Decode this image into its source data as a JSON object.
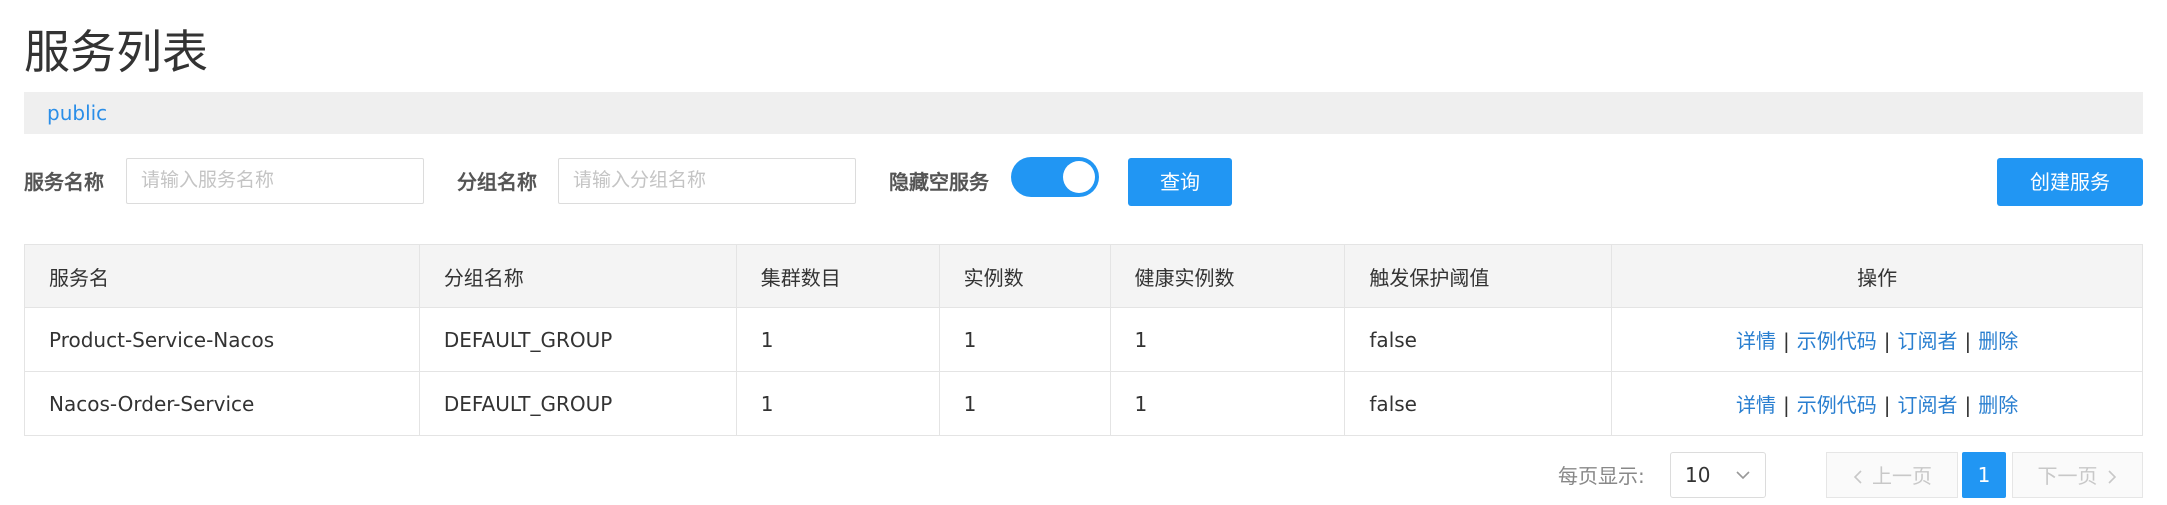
{
  "page": {
    "title": "服务列表"
  },
  "namespace": {
    "active": "public"
  },
  "filters": {
    "service_name_label": "服务名称",
    "service_name_placeholder": "请输入服务名称",
    "group_name_label": "分组名称",
    "group_name_placeholder": "请输入分组名称",
    "hide_empty_label": "隐藏空服务",
    "hide_empty_enabled": true,
    "query_button": "查询"
  },
  "create_button": "创建服务",
  "colors": {
    "accent": "#2196f3",
    "link": "#2a7fd0",
    "namespace_bar": "#efefef"
  },
  "table": {
    "headers": [
      "服务名",
      "分组名称",
      "集群数目",
      "实例数",
      "健康实例数",
      "触发保护阈值",
      "操作"
    ],
    "rows": [
      {
        "service": "Product-Service-Nacos",
        "group": "DEFAULT_GROUP",
        "clusters": "1",
        "instances": "1",
        "healthy": "1",
        "threshold": "false"
      },
      {
        "service": "Nacos-Order-Service",
        "group": "DEFAULT_GROUP",
        "clusters": "1",
        "instances": "1",
        "healthy": "1",
        "threshold": "false"
      }
    ],
    "actions": {
      "detail": "详情",
      "sample": "示例代码",
      "subscribers": "订阅者",
      "delete": "删除"
    }
  },
  "pagination": {
    "page_size_label": "每页显示:",
    "page_size": "10",
    "prev": "上一页",
    "current": "1",
    "next": "下一页"
  }
}
